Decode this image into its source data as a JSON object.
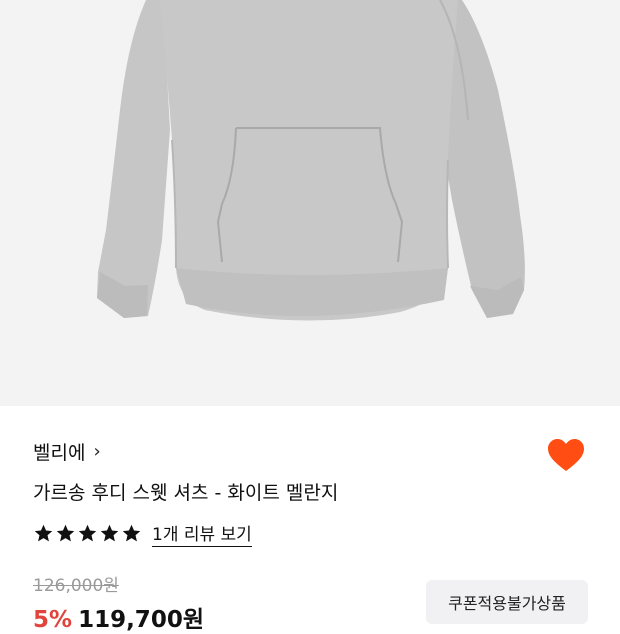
{
  "product": {
    "brand": "벨리에",
    "title": "가르송 후디 스웻 셔츠 - 화이트 멜란지",
    "rating_stars": 5,
    "review_link": "1개 리뷰 보기",
    "original_price": "126,000원",
    "discount_rate": "5%",
    "sale_price": "119,700원",
    "coupon_badge": "쿠폰적용불가상품"
  },
  "icons": {
    "brand_chevron": "chevron-right-icon",
    "wishlist": "heart-icon",
    "rating": "star-icon"
  },
  "colors": {
    "heart": "#ff4d14",
    "discount": "#e0443a",
    "image_background": "#f3f3f3",
    "hoodie": "#c8c8c8"
  }
}
